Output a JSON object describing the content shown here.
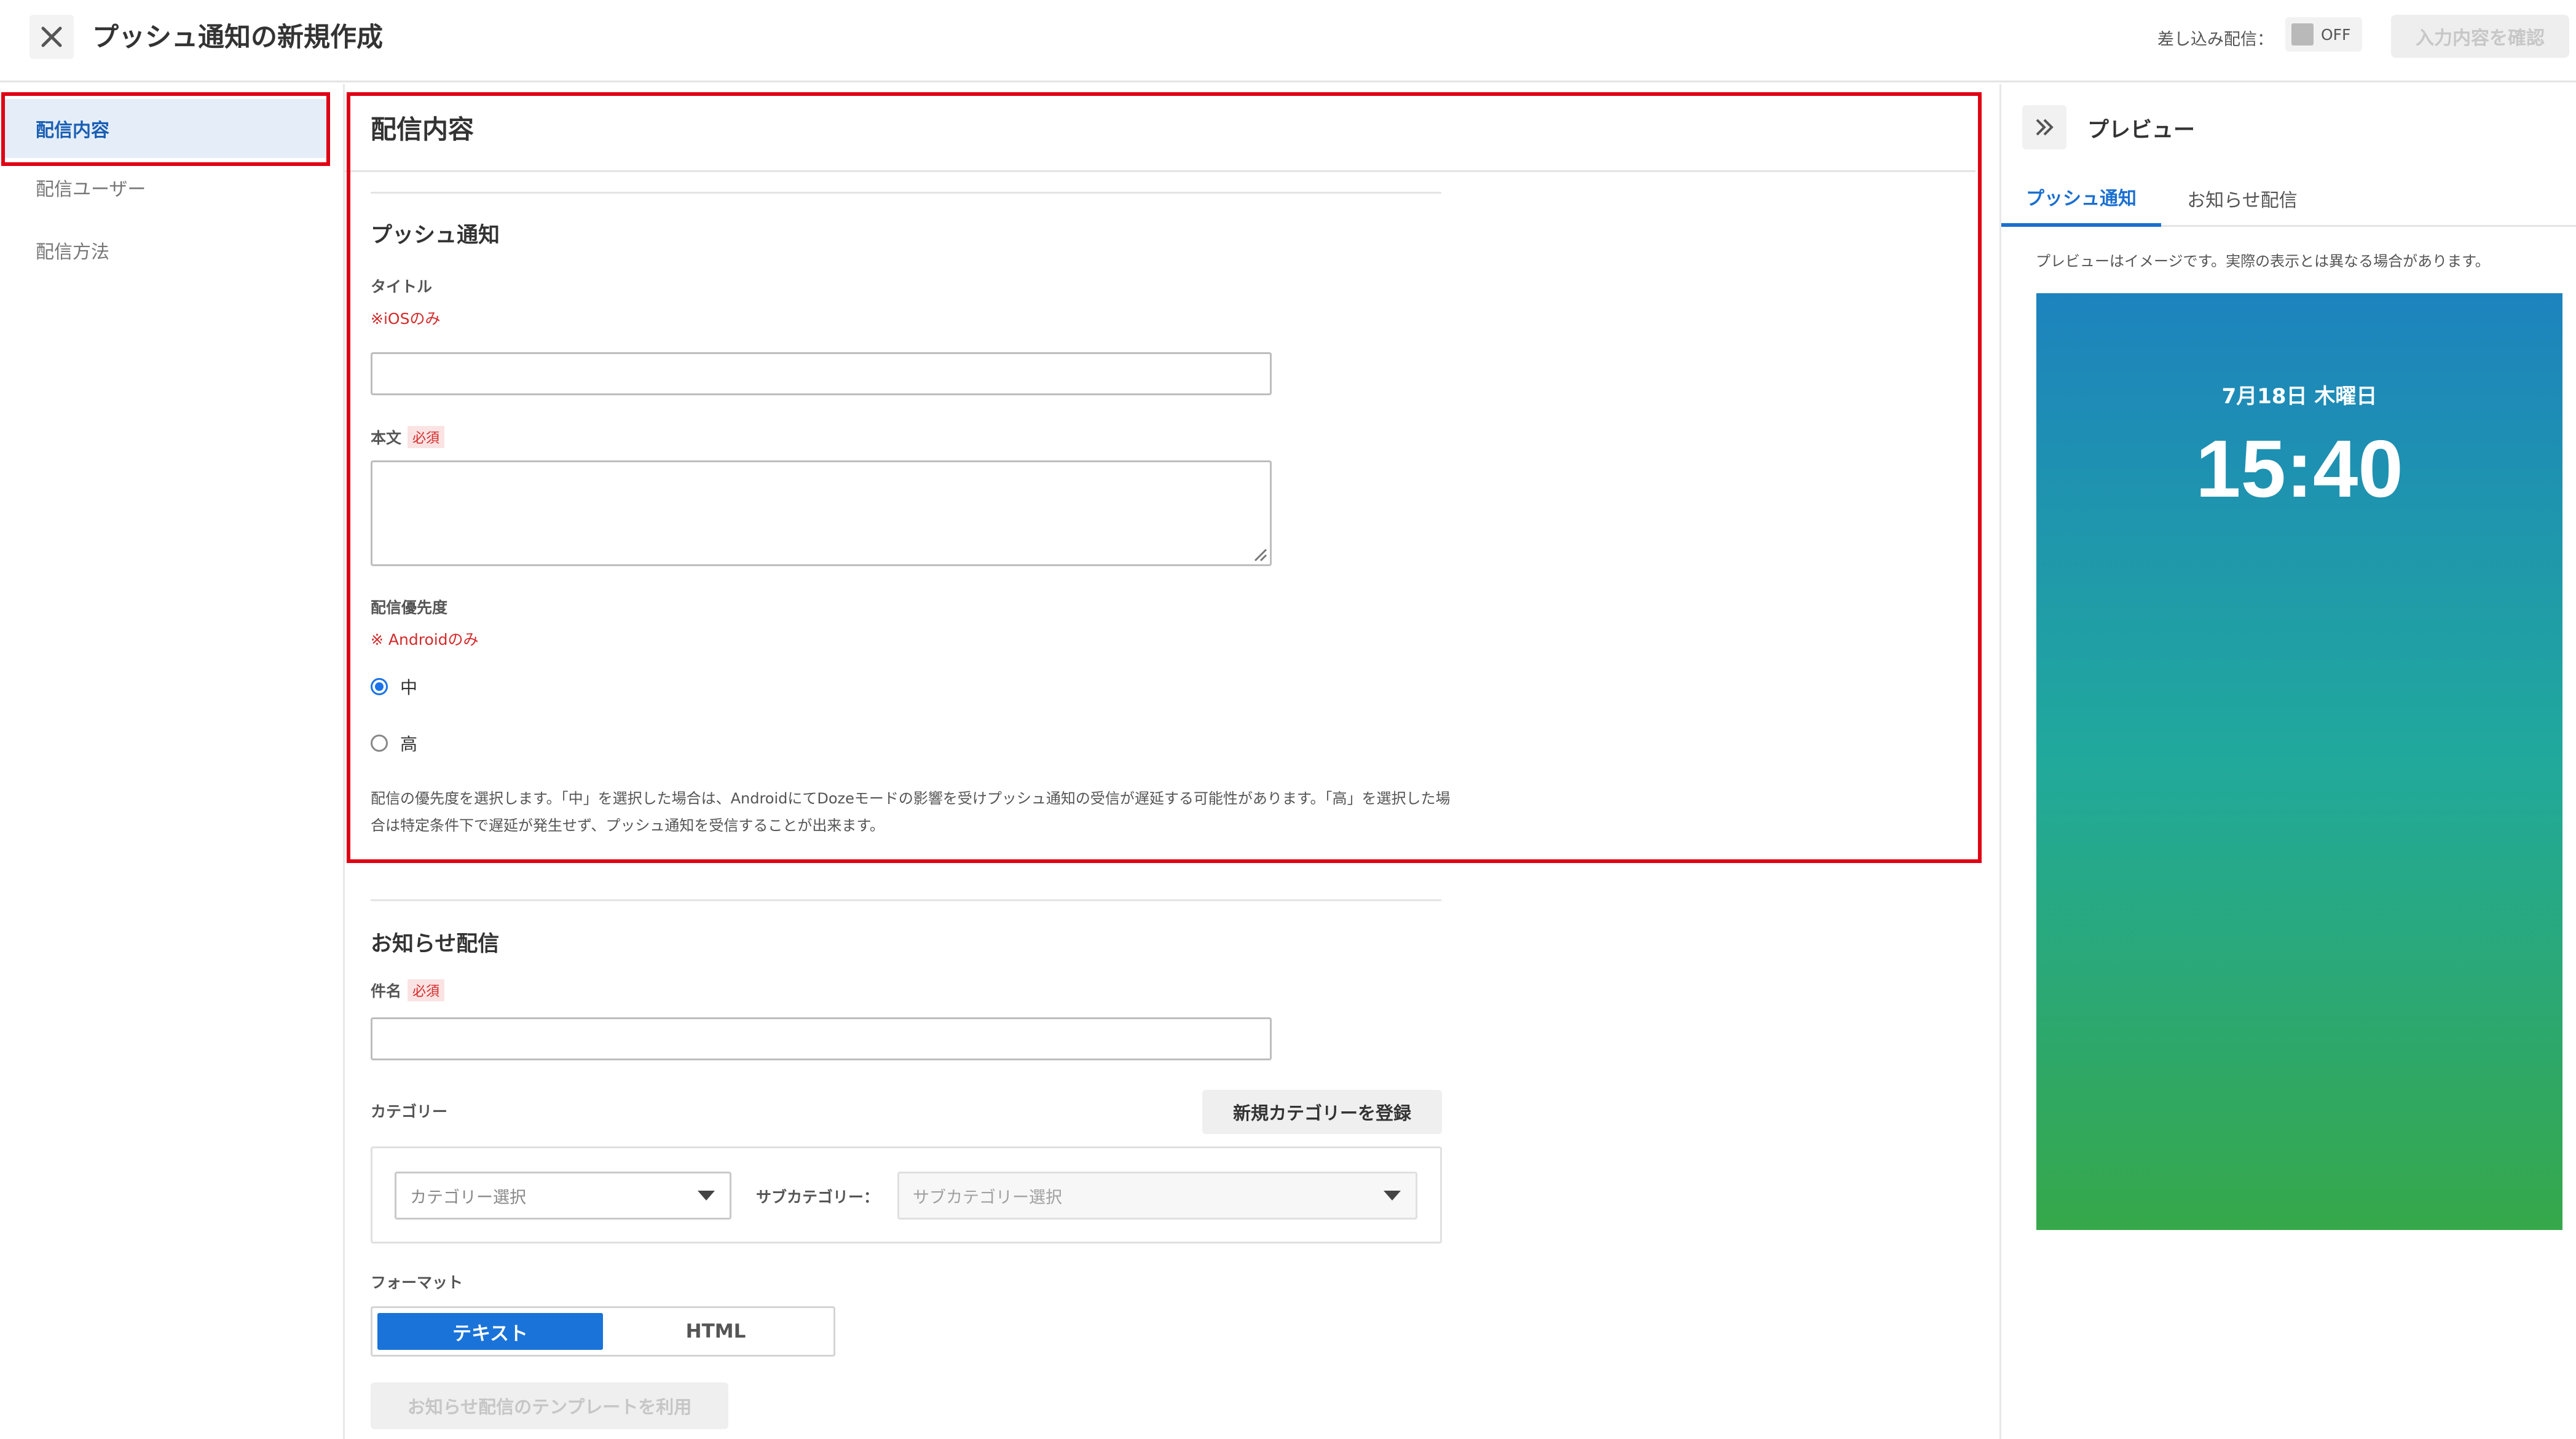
{
  "header": {
    "title": "プッシュ通知の新規作成",
    "merge_label": "差し込み配信：",
    "merge_toggle": "OFF",
    "confirm_button": "入力内容を確認"
  },
  "sidebar": {
    "items": [
      {
        "label": "配信内容",
        "active": true
      },
      {
        "label": "配信ユーザー",
        "active": false
      },
      {
        "label": "配信方法",
        "active": false
      }
    ]
  },
  "main": {
    "section_title": "配信内容",
    "push": {
      "heading": "プッシュ通知",
      "title_label": "タイトル",
      "title_note": "※iOSのみ",
      "title_value": "",
      "body_label": "本文",
      "required": "必須",
      "body_value": "",
      "priority_label": "配信優先度",
      "priority_note": "※ Androidのみ",
      "options": [
        "中",
        "高"
      ],
      "selected": "中",
      "help": "配信の優先度を選択します。「中」を選択した場合は、AndroidにてDozeモードの影響を受けプッシュ通知の受信が遅延する可能性があります。「高」を選択した場合は特定条件下で遅延が発生せず、プッシュ通知を受信することが出来ます。"
    },
    "notice": {
      "heading": "お知らせ配信",
      "subject_label": "件名",
      "required": "必須",
      "subject_value": "",
      "category_label": "カテゴリー",
      "new_category_button": "新規カテゴリーを登録",
      "category_placeholder": "カテゴリー選択",
      "subcategory_label": "サブカテゴリー：",
      "subcategory_placeholder": "サブカテゴリー選択",
      "format_label": "フォーマット",
      "formats": [
        "テキスト",
        "HTML"
      ],
      "selected_format": "テキスト",
      "template_button": "お知らせ配信のテンプレートを利用"
    }
  },
  "preview": {
    "title": "プレビュー",
    "tabs": [
      "プッシュ通知",
      "お知らせ配信"
    ],
    "active_tab": "プッシュ通知",
    "note": "プレビューはイメージです。実際の表示とは異なる場合があります。",
    "phone_date": "7月18日 木曜日",
    "phone_time": "15:40"
  },
  "colors": {
    "accent": "#1a73d8",
    "highlight_border": "#e00014",
    "required": "#d42a2a"
  }
}
